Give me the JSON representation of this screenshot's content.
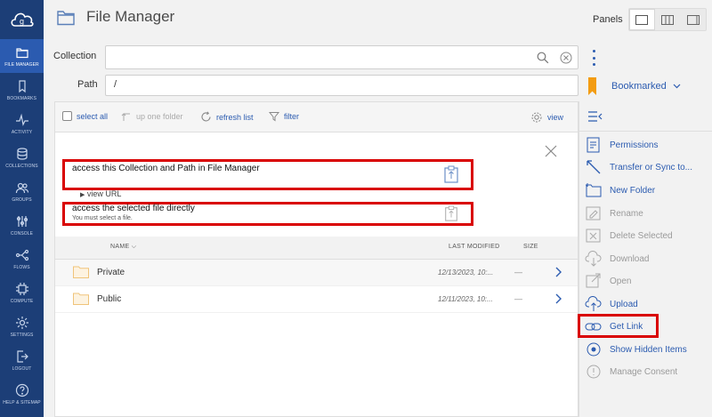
{
  "nav": {
    "items": [
      {
        "label": "FILE MANAGER",
        "icon": "folder-icon",
        "active": true
      },
      {
        "label": "BOOKMARKS",
        "icon": "bookmark-icon"
      },
      {
        "label": "ACTIVITY",
        "icon": "activity-icon"
      },
      {
        "label": "COLLECTIONS",
        "icon": "collections-icon"
      },
      {
        "label": "GROUPS",
        "icon": "groups-icon"
      },
      {
        "label": "CONSOLE",
        "icon": "console-icon"
      },
      {
        "label": "FLOWS",
        "icon": "flows-icon"
      },
      {
        "label": "COMPUTE",
        "icon": "compute-icon"
      },
      {
        "label": "SETTINGS",
        "icon": "gear-icon"
      },
      {
        "label": "LOGOUT",
        "icon": "logout-icon"
      },
      {
        "label": "HELP & SITEMAP",
        "icon": "help-icon"
      }
    ]
  },
  "header": {
    "title": "File Manager",
    "panels_label": "Panels"
  },
  "form": {
    "collection_label": "Collection",
    "collection_value": "",
    "path_label": "Path",
    "path_value": "/",
    "bookmarked_label": "Bookmarked"
  },
  "toolbar": {
    "select_all": "select all",
    "up_one_folder": "up one folder",
    "refresh_list": "refresh list",
    "filter": "filter",
    "view": "view"
  },
  "link_panel": {
    "collection_link_title": "access this Collection and Path in File Manager",
    "view_url": "view URL",
    "file_link_title": "access the selected file directly",
    "file_link_sub": "You must select a file."
  },
  "table": {
    "headers": {
      "name": "NAME",
      "modified": "LAST MODIFIED",
      "size": "SIZE"
    },
    "rows": [
      {
        "name": "Private",
        "modified": "12/13/2023, 10:...",
        "size": "—"
      },
      {
        "name": "Public",
        "modified": "12/11/2023, 10:...",
        "size": "—"
      }
    ]
  },
  "actions": [
    {
      "label": "Permissions",
      "icon": "permissions-icon",
      "enabled": true
    },
    {
      "label": "Transfer or Sync to...",
      "icon": "transfer-icon",
      "enabled": true
    },
    {
      "label": "New Folder",
      "icon": "new-folder-icon",
      "enabled": true
    },
    {
      "label": "Rename",
      "icon": "rename-icon",
      "enabled": false
    },
    {
      "label": "Delete Selected",
      "icon": "delete-icon",
      "enabled": false
    },
    {
      "label": "Download",
      "icon": "download-icon",
      "enabled": false
    },
    {
      "label": "Open",
      "icon": "open-icon",
      "enabled": false
    },
    {
      "label": "Upload",
      "icon": "upload-icon",
      "enabled": true
    },
    {
      "label": "Get Link",
      "icon": "link-icon",
      "enabled": true
    },
    {
      "label": "Show Hidden Items",
      "icon": "eye-icon",
      "enabled": true
    },
    {
      "label": "Manage Consent",
      "icon": "consent-icon",
      "enabled": false
    }
  ],
  "colors": {
    "nav_bg": "#1c3e77",
    "nav_active": "#2b5bb0",
    "accent": "#2b5bb0",
    "highlight": "#d90000",
    "bookmark": "#f39c12"
  }
}
